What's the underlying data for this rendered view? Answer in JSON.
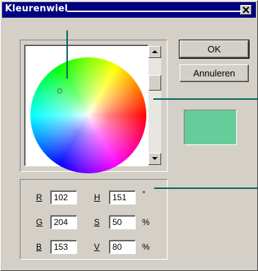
{
  "window": {
    "title": "Kleurenwiel"
  },
  "buttons": {
    "ok": "OK",
    "cancel": "Annuleren"
  },
  "preview": {
    "color": "#66cc99"
  },
  "colors": {
    "titlebar": "#000080",
    "face": "#d4d0c8",
    "callout": "#006060"
  },
  "fields": {
    "r": {
      "label": "R",
      "value": "102"
    },
    "g": {
      "label": "G",
      "value": "204"
    },
    "b": {
      "label": "B",
      "value": "153"
    },
    "h": {
      "label": "H",
      "value": "151",
      "unit": "°"
    },
    "s": {
      "label": "S",
      "value": "50",
      "unit": "%"
    },
    "v": {
      "label": "V",
      "value": "80",
      "unit": "%"
    }
  },
  "icons": {
    "close": "close-icon",
    "scroll_up": "arrow-up-icon",
    "scroll_down": "arrow-down-icon"
  }
}
